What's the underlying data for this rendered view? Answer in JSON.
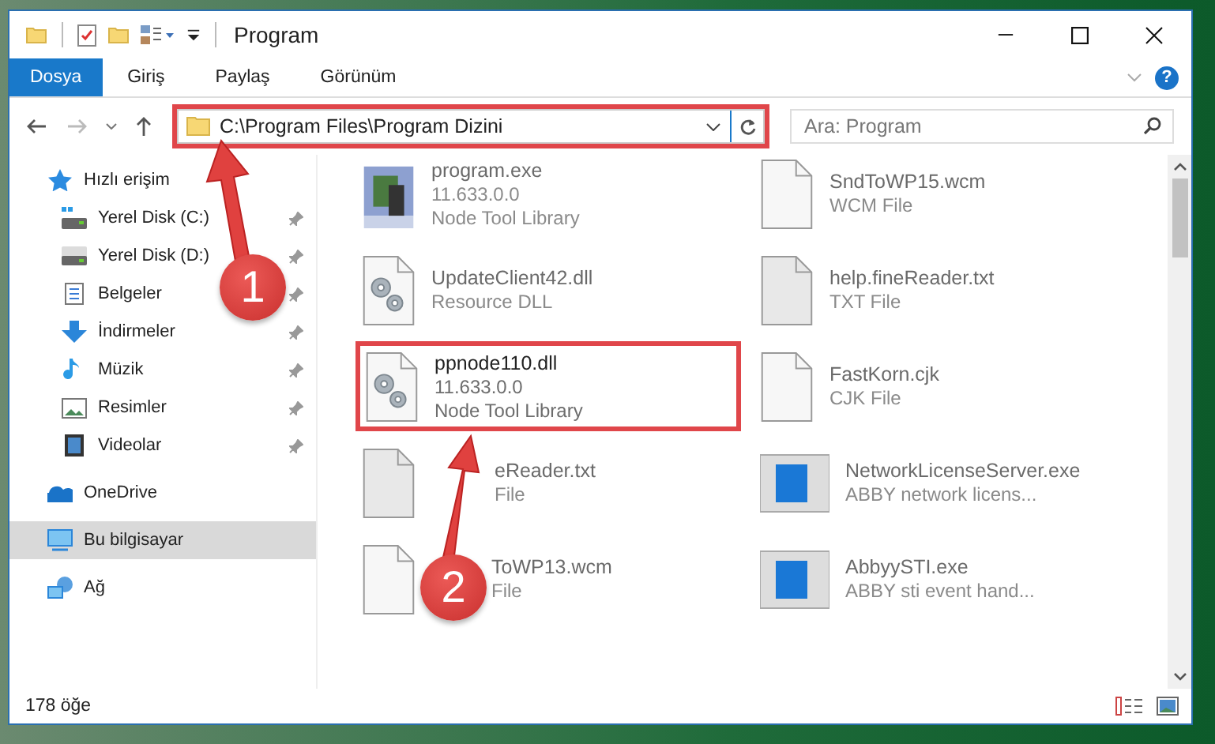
{
  "window": {
    "title": "Program"
  },
  "ribbon": {
    "tabs": [
      {
        "label": "Dosya",
        "selected": true
      },
      {
        "label": "Giriş",
        "selected": false
      },
      {
        "label": "Paylaş",
        "selected": false
      },
      {
        "label": "Görünüm",
        "selected": false
      }
    ],
    "help": "?"
  },
  "address": {
    "path": "C:\\Program Files\\Program Dizini",
    "highlighted": true
  },
  "search": {
    "placeholder": "Ara: Program"
  },
  "sidebar": {
    "items": [
      {
        "label": "Hızlı erişim",
        "kind": "star",
        "selected": false,
        "children": [
          {
            "label": "Yerel Disk (C:)",
            "kind": "drive-c",
            "pinned": true,
            "selected": false
          },
          {
            "label": "Yerel Disk (D:)",
            "kind": "drive",
            "pinned": true,
            "selected": false
          },
          {
            "label": "Belgeler",
            "kind": "documents",
            "pinned": true,
            "selected": false
          },
          {
            "label": "İndirmeler",
            "kind": "download",
            "pinned": true,
            "selected": false
          },
          {
            "label": "Müzik",
            "kind": "music",
            "pinned": true,
            "selected": false
          },
          {
            "label": "Resimler",
            "kind": "pictures",
            "pinned": true,
            "selected": false
          },
          {
            "label": "Videolar",
            "kind": "videos",
            "pinned": true,
            "selected": false
          }
        ]
      },
      {
        "label": "OneDrive",
        "kind": "cloud",
        "selected": false
      },
      {
        "label": "Bu bilgisayar",
        "kind": "computer",
        "selected": true
      },
      {
        "label": "Ağ",
        "kind": "network",
        "selected": false
      }
    ]
  },
  "files": [
    {
      "name": "program.exe",
      "details": [
        "11.633.0.0",
        "Node Tool Library"
      ],
      "kind": "app",
      "blurred": true,
      "highlighted": false
    },
    {
      "name": "SndToWP15.wcm",
      "details": [
        "WCM File"
      ],
      "kind": "blank",
      "blurred": true,
      "highlighted": false
    },
    {
      "name": "UpdateClient42.dll",
      "details": [
        "Resource DLL"
      ],
      "kind": "gears",
      "blurred": true,
      "highlighted": false
    },
    {
      "name": "help.fineReader.txt",
      "details": [
        "TXT File"
      ],
      "kind": "text",
      "blurred": true,
      "highlighted": false
    },
    {
      "name": "ppnode110.dll",
      "details": [
        "11.633.0.0",
        "Node Tool Library"
      ],
      "kind": "gears",
      "blurred": false,
      "highlighted": true
    },
    {
      "name": "FastKorn.cjk",
      "details": [
        "CJK File"
      ],
      "kind": "blank",
      "blurred": true,
      "highlighted": false
    },
    {
      "name": "eReader.txt",
      "details": [
        "File"
      ],
      "kind": "text",
      "blurred": true,
      "highlighted": false
    },
    {
      "name": "NetworkLicenseServer.exe",
      "details": [
        "ABBY network licens..."
      ],
      "kind": "window",
      "blurred": true,
      "highlighted": false
    },
    {
      "name": "ToWP13.wcm",
      "details": [
        "File"
      ],
      "kind": "blank",
      "blurred": true,
      "highlighted": false
    },
    {
      "name": "AbbyySTI.exe",
      "details": [
        "ABBY sti event hand..."
      ],
      "kind": "window",
      "blurred": true,
      "highlighted": false
    }
  ],
  "status_bar": {
    "count": "178 öğe"
  },
  "annotations": [
    {
      "number": "1"
    },
    {
      "number": "2"
    }
  ]
}
